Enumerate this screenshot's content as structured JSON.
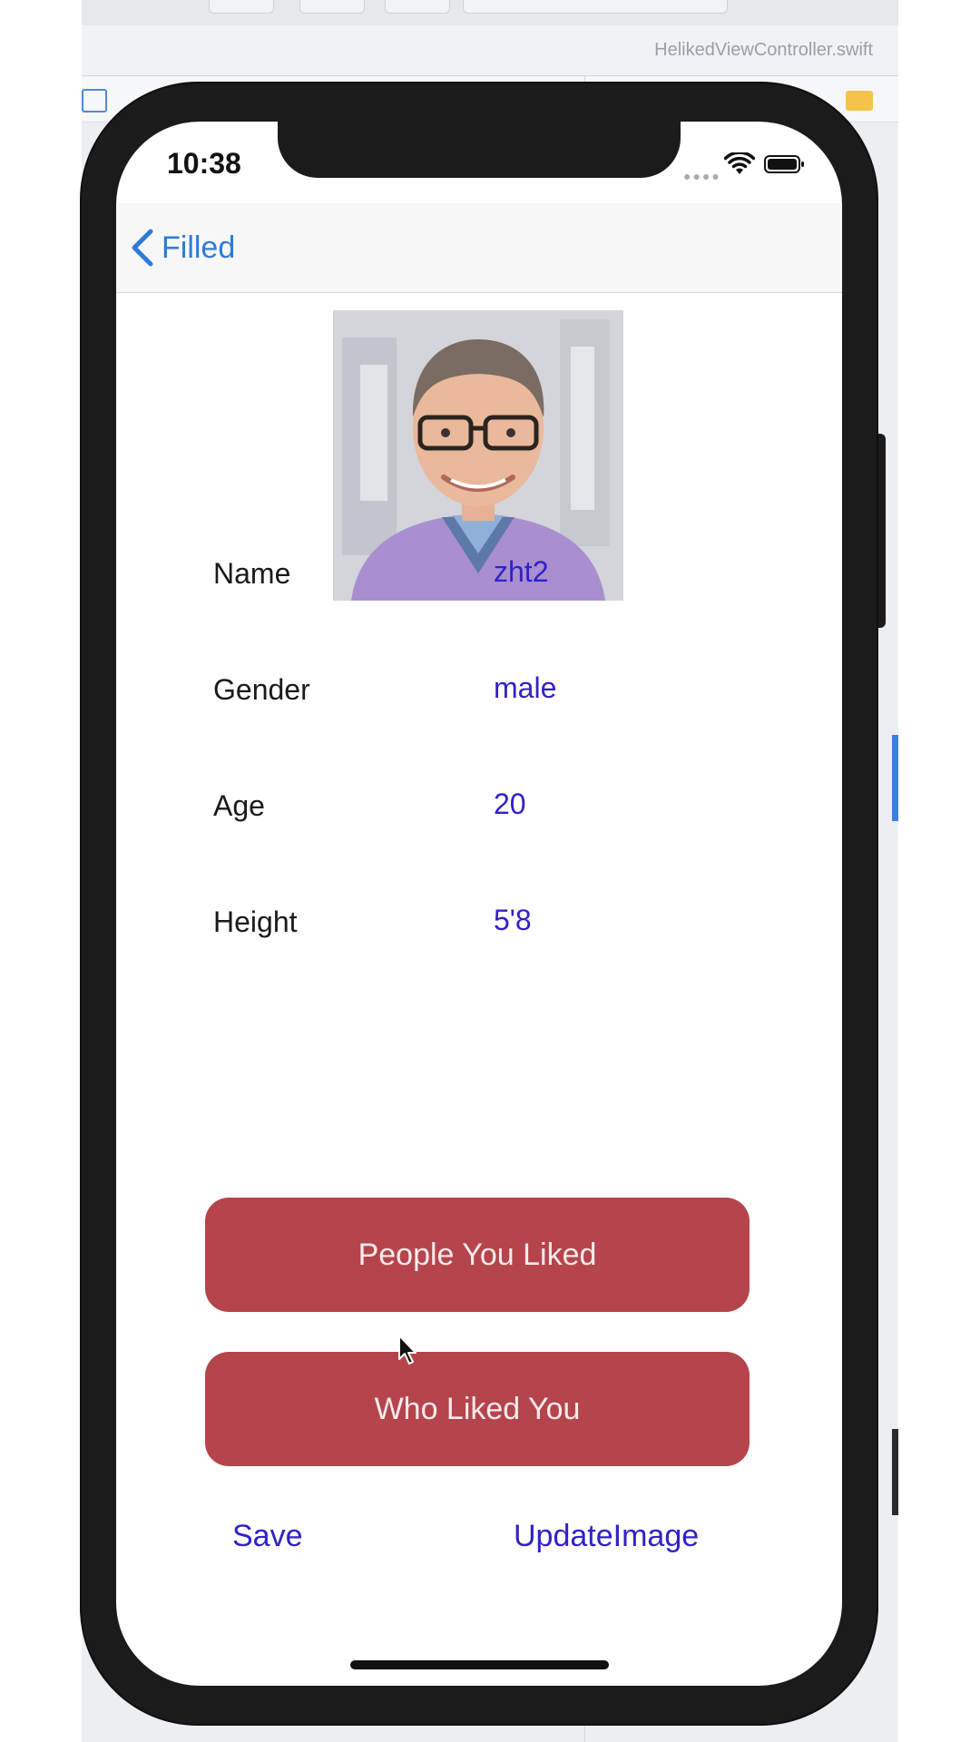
{
  "xcode": {
    "tab_title": "HelikedViewController.swift"
  },
  "status_bar": {
    "time": "10:38"
  },
  "nav": {
    "back_label": "Filled"
  },
  "profile": {
    "fields": [
      {
        "label": "Name",
        "value": "zht2"
      },
      {
        "label": "Gender",
        "value": "male"
      },
      {
        "label": "Age",
        "value": "20"
      },
      {
        "label": "Height",
        "value": "5'8"
      }
    ]
  },
  "buttons": {
    "people_you_liked": "People You Liked",
    "who_liked_you": "Who Liked You",
    "save": "Save",
    "update_image": "UpdateImage"
  },
  "colors": {
    "accent_button": "#b6444c",
    "value_text": "#2f22c7",
    "nav_tint": "#2f7bd8"
  }
}
